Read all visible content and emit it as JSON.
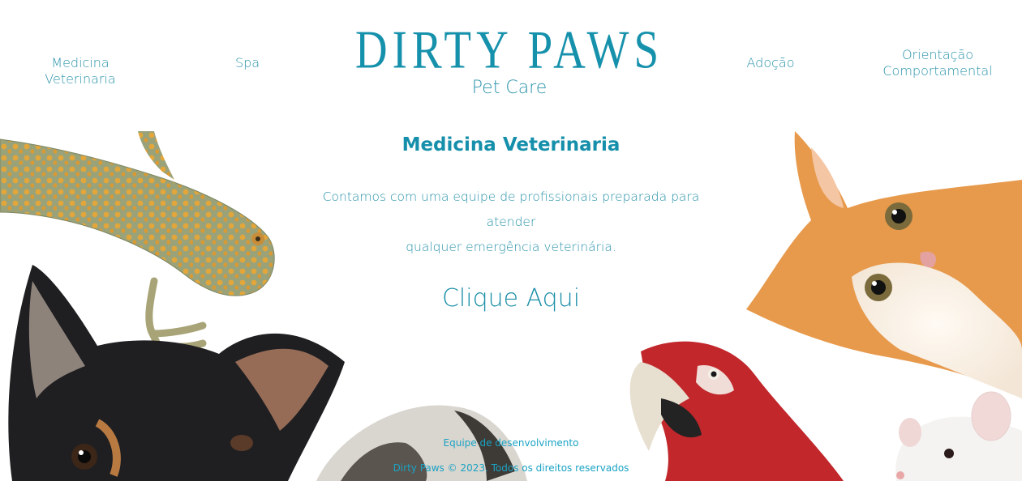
{
  "nav": {
    "left": [
      "Medicina Veterinaria",
      "Spa"
    ],
    "right": [
      "Adoção",
      "Orientação Comportamental"
    ],
    "right_line1": "Orientação",
    "right_line2": "Comportamental"
  },
  "brand": {
    "title": "DIRTY PAWS",
    "subtitle": "Pet Care"
  },
  "hero": {
    "title": "Medicina Veterinaria",
    "description_line1": "Contamos com uma equipe de profissionais preparada para atender",
    "description_line2": "qualquer emergência veterinária.",
    "cta_label": "Clique Aqui"
  },
  "footer": {
    "team_link": "Equipe de desenvolvimento",
    "copyright": "Dirty Paws © 2023. Todos os direitos reservados"
  },
  "colors": {
    "accent": "#1691ac",
    "text": "#2a93aa"
  },
  "images": [
    "gecko",
    "dog",
    "rabbit",
    "parrot",
    "kitten",
    "mouse"
  ]
}
